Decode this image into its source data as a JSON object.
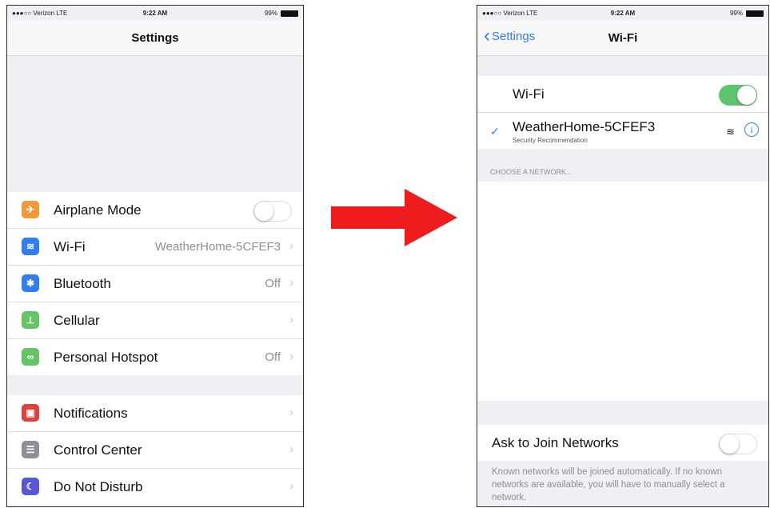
{
  "colors": {
    "accent": "#2f7ef6",
    "toggle_on": "#5fc46f",
    "arrow": "#ee1c1c"
  },
  "left_screen": {
    "status": {
      "carrier": "●●●○○ Verizon  LTE",
      "time": "9:22 AM",
      "battery": "99%"
    },
    "title": "Settings",
    "groups": [
      [
        {
          "icon": "airplane-icon",
          "icon_color": "#f09a37",
          "glyph": "✈",
          "label": "Airplane Mode",
          "toggle": "off"
        },
        {
          "icon": "wifi-icon",
          "icon_color": "#2f7ef6",
          "glyph": "≋",
          "label": "Wi-Fi",
          "value": "WeatherHome-5CFEF3",
          "chevron": "›"
        },
        {
          "icon": "bluetooth-icon",
          "icon_color": "#2f7ef6",
          "glyph": "✱",
          "label": "Bluetooth",
          "value": "Off",
          "chevron": "›"
        },
        {
          "icon": "cellular-icon",
          "icon_color": "#65c466",
          "glyph": "⊥",
          "label": "Cellular",
          "chevron": "›"
        },
        {
          "icon": "hotspot-icon",
          "icon_color": "#65c466",
          "glyph": "∞",
          "label": "Personal Hotspot",
          "value": "Off",
          "chevron": "›"
        }
      ],
      [
        {
          "icon": "notifications-icon",
          "icon_color": "#e2403c",
          "glyph": "▣",
          "label": "Notifications",
          "chevron": "›"
        },
        {
          "icon": "control-center-icon",
          "icon_color": "#8e8e93",
          "glyph": "☰",
          "label": "Control Center",
          "chevron": "›"
        },
        {
          "icon": "do-not-disturb-icon",
          "icon_color": "#5856d6",
          "glyph": "☾",
          "label": "Do Not Disturb",
          "chevron": "›"
        }
      ]
    ]
  },
  "right_screen": {
    "status": {
      "carrier": "●●●○○ Verizon  LTE",
      "time": "9:22 AM",
      "battery": "99%"
    },
    "back_label": "Settings",
    "title": "Wi-Fi",
    "wifi_row": {
      "label": "Wi-Fi",
      "toggle": "on"
    },
    "connected_network": {
      "name": "WeatherHome-5CFEF3",
      "subtitle": "Security Recommendation",
      "check": "✓",
      "info": "i",
      "wifi_glyph": "≋"
    },
    "choose_header": "CHOOSE A NETWORK...",
    "ask_to_join": {
      "label": "Ask to Join Networks",
      "toggle": "off"
    },
    "footer": "Known networks will be joined automatically. If no known networks are available, you will have to manually select a network."
  }
}
